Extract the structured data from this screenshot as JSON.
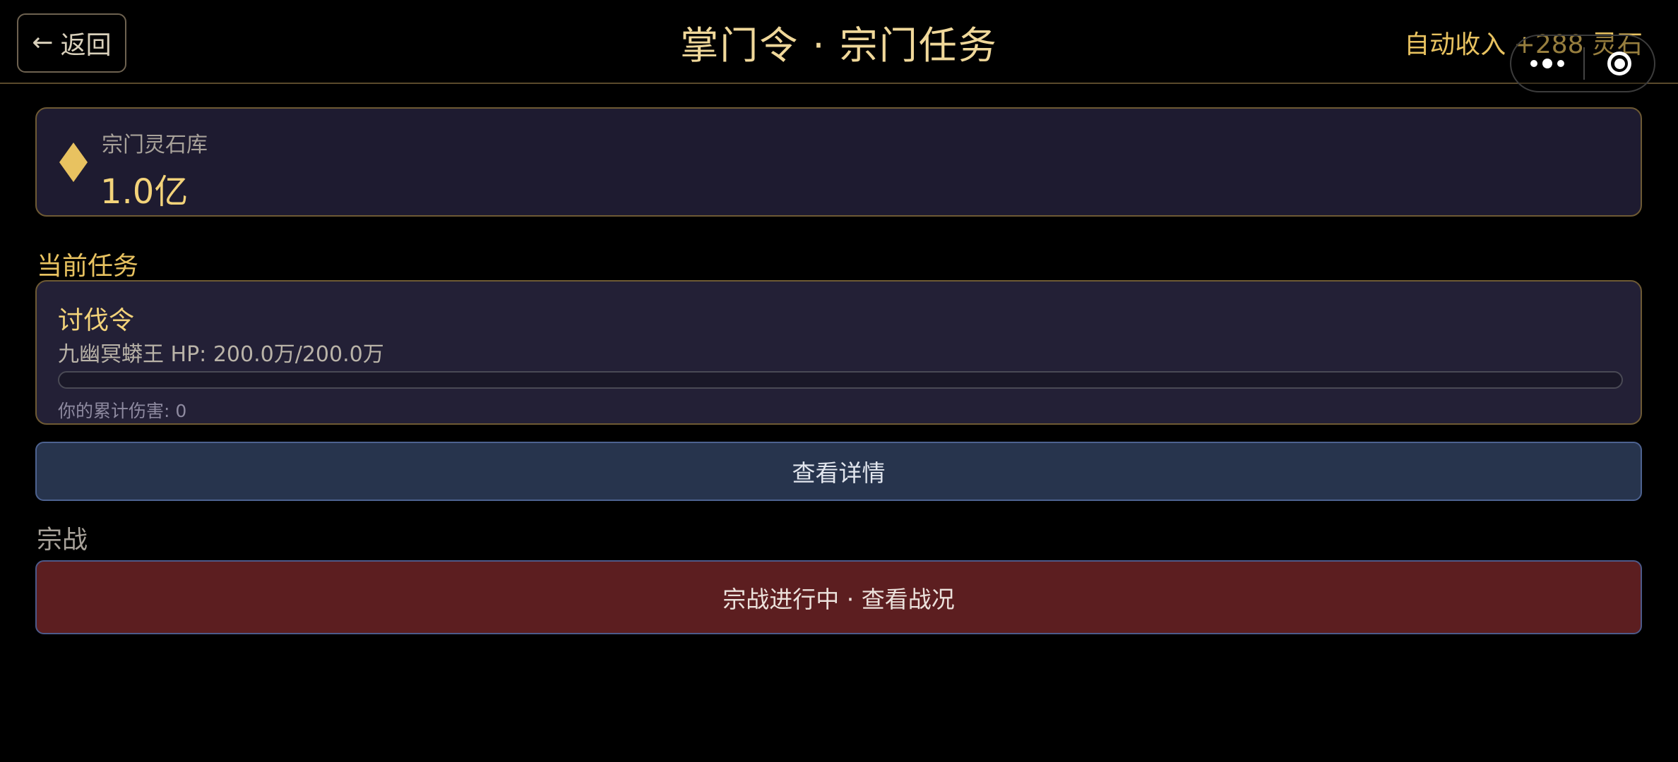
{
  "header": {
    "back_label": "返回",
    "back_arrow": "←",
    "title": "掌门令 · 宗门任务",
    "income": "自动收入 +288 灵石"
  },
  "vault": {
    "label": "宗门灵石库",
    "value": "1.0亿",
    "icon": "gem-icon",
    "icon_color": "#e8c260"
  },
  "current_task": {
    "section_title": "当前任务",
    "name": "讨伐令",
    "boss": "九幽冥蟒王 HP: 200.0万/200.0万",
    "hp_fraction": 1.0,
    "damage": "你的累计伤害: 0"
  },
  "detail_button": {
    "label": "查看详情"
  },
  "sect_war": {
    "section_title": "宗战",
    "button_label": "宗战进行中 · 查看战况"
  },
  "capsule": {
    "more_icon": "more-dots-icon",
    "close_icon": "target-close-icon"
  },
  "colors": {
    "accent_gold": "#f3d37a",
    "detail_bg": "#27344d",
    "war_bg": "#5c1e20"
  }
}
